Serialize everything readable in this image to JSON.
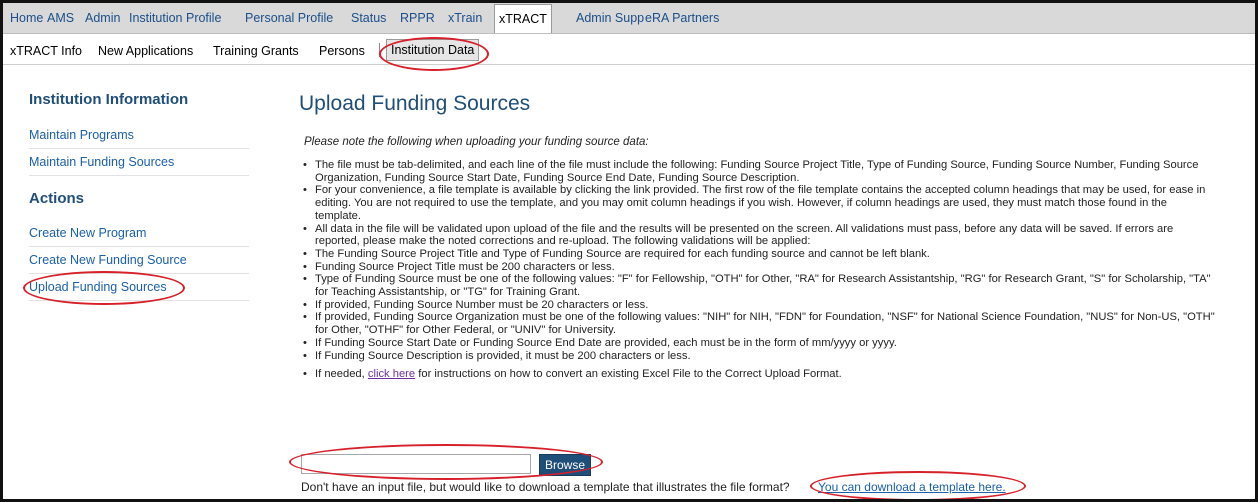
{
  "top_nav": {
    "items": [
      "Home",
      "AMS",
      "Admin",
      "Institution Profile",
      "Personal Profile",
      "Status",
      "RPPR",
      "xTrain",
      "xTRACT",
      "Admin Supp",
      "eRA Partners"
    ],
    "active": "xTRACT"
  },
  "sub_nav": {
    "items": [
      "xTRACT Info",
      "New Applications",
      "Training Grants",
      "Persons",
      "Institution Data"
    ],
    "active": "Institution Data"
  },
  "sidebar": {
    "section1_title": "Institution Information",
    "section1_items": [
      "Maintain Programs",
      "Maintain Funding Sources"
    ],
    "section2_title": "Actions",
    "section2_items": [
      "Create New Program",
      "Create New Funding Source",
      "Upload Funding Sources"
    ]
  },
  "main": {
    "title": "Upload Funding Sources",
    "intro": "Please note the following when uploading your funding source data:",
    "notes": [
      "The file must be tab-delimited, and each line of the file must include the following:  Funding Source Project Title, Type of Funding Source, Funding Source Number, Funding Source Organization, Funding Source Start Date, Funding Source End Date, Funding Source Description.",
      "For your convenience, a file template is available by clicking the link provided.  The first row of the file template contains the accepted column headings that may be used, for ease in editing.  You are not required to use the template, and you may omit column headings if you wish.  However, if column headings are used, they must match those found in the template.",
      "All data in the file will be validated upon upload of the file and the results will be presented on the screen.  All validations must pass, before any data will be saved.  If errors are reported, please make the noted corrections and re-upload.  The following validations will be applied:",
      "The Funding Source Project Title and Type of Funding Source are required for each funding source and cannot be left blank.",
      "Funding Source Project Title must be 200 characters or less.",
      "Type of Funding Source must be one of the following values:  \"F\" for Fellowship, \"OTH\" for Other, \"RA\" for Research Assistantship, \"RG\" for Research Grant, \"S\" for Scholarship, \"TA\" for Teaching Assistantship, or \"TG\" for Training Grant.",
      "If provided, Funding Source Number must be 20 characters or less.",
      "If provided, Funding Source Organization must be one of the following values:  \"NIH\" for NIH, \"FDN\" for Foundation, \"NSF\" for National Science Foundation, \"NUS\" for Non-US, \"OTH\" for Other, \"OTHF\" for Other Federal, or \"UNIV\" for University.",
      "If Funding Source Start Date or Funding Source End Date are provided, each must be in the form of mm/yyyy or yyyy.",
      "If Funding Source Description is provided, it must be 200 characters or less."
    ],
    "last_note_prefix": "If needed, ",
    "last_note_link": "click here",
    "last_note_suffix": " for instructions on how to convert an existing Excel File to the Correct Upload Format.",
    "browse_label": "Browse",
    "file_value": "",
    "download_prompt": "Don't have an input file, but would like to download a template that illustrates the file format?",
    "download_link": "You can download a template here."
  },
  "colors": {
    "heading": "#1f4e79",
    "link": "#1a5fa8",
    "highlight_circle": "#d7202a",
    "button_bg": "#1f4e79"
  }
}
